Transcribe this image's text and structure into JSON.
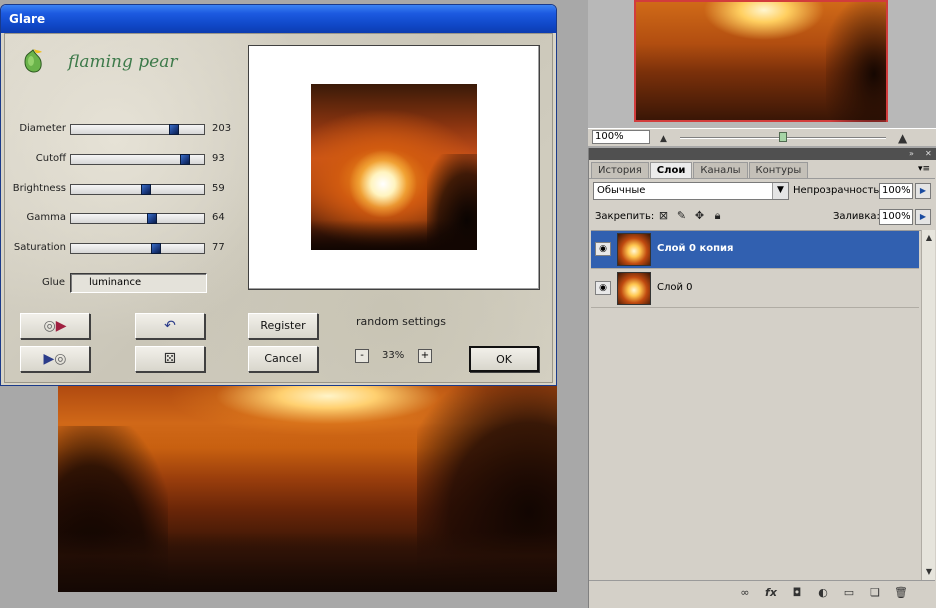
{
  "dialog": {
    "title": "Glare",
    "brand": "flaming pear",
    "sliders": [
      {
        "label": "Diameter",
        "value": "203",
        "position": 0.8
      },
      {
        "label": "Cutoff",
        "value": "93",
        "position": 0.89
      },
      {
        "label": "Brightness",
        "value": "59",
        "position": 0.57
      },
      {
        "label": "Gamma",
        "value": "64",
        "position": 0.62
      },
      {
        "label": "Saturation",
        "value": "77",
        "position": 0.65
      }
    ],
    "glue_label": "Glue",
    "glue_value": "luminance",
    "register_label": "Register",
    "cancel_label": "Cancel",
    "ok_label": "OK",
    "random_settings": "random settings",
    "zoom_minus": "-",
    "zoom_plus": "+",
    "zoom_value": "33%"
  },
  "navigator": {
    "zoom_value": "100%"
  },
  "layers_panel": {
    "tabs": [
      "История",
      "Слои",
      "Каналы",
      "Контуры"
    ],
    "active_tab": 1,
    "blend_mode": "Обычные",
    "opacity_label": "Непрозрачность:",
    "opacity_value": "100%",
    "lock_label": "Закрепить:",
    "fill_label": "Заливка:",
    "fill_value": "100%",
    "layers": [
      {
        "name": "Слой 0 копия",
        "selected": true
      },
      {
        "name": "Слой 0",
        "selected": false
      }
    ]
  },
  "icons": {
    "eye": "eye-icon",
    "lock": "lock-icon",
    "link": "link-icon",
    "fx": "fx-icon",
    "mask": "mask-icon",
    "adjustment": "adjustment-icon",
    "folder": "folder-icon",
    "new_layer": "new-layer-icon",
    "trash": "trash-icon"
  },
  "colors": {
    "title_bar": "#1c5ae0",
    "selected_layer": "#3160b0",
    "brand_text": "#3d7a4a",
    "thumb_border": "#d23c3c"
  }
}
